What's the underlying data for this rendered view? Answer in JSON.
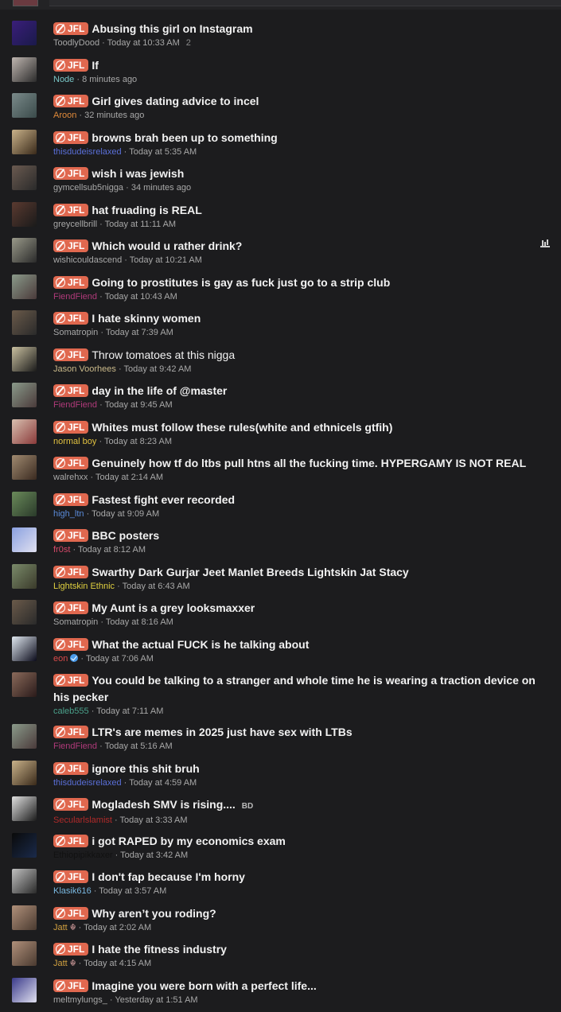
{
  "prefix_label": "JFL",
  "colors": {
    "prefix_bg": "#e0684f",
    "background": "#1c1c1e",
    "meta_gray": "#a8a8a8"
  },
  "threads": [
    {
      "title": "Abusing this girl on Instagram",
      "user": "ToodlyDood",
      "user_color": "#a8a8a8",
      "time": "Today at 10:33 AM",
      "replies": "2",
      "avatar": [
        "#3a1e7a",
        "#1a1a4a"
      ]
    },
    {
      "title": "If",
      "user": "Node",
      "user_color": "#79c7c7",
      "time": "8 minutes ago",
      "avatar": [
        "#bfb6b0",
        "#2b2b2b"
      ]
    },
    {
      "title": "Girl gives dating advice to incel",
      "user": "Aroon",
      "user_color": "#e08a3a",
      "time": "32 minutes ago",
      "avatar": [
        "#7a8a8a",
        "#3a4a4a"
      ]
    },
    {
      "title": "browns brah been up to something",
      "user": "thisdudeisrelaxed",
      "user_color": "#5a6fd8",
      "time": "Today at 5:35 AM",
      "avatar": [
        "#c9b28a",
        "#3a2a1a"
      ]
    },
    {
      "title": "wish i was jewish",
      "user": "gymcellsub5nigga",
      "user_color": "#a8a8a8",
      "time": "34 minutes ago",
      "avatar": [
        "#6a5a50",
        "#2a2a2a"
      ]
    },
    {
      "title": "hat fruading is REAL",
      "user": "greycellbrill",
      "user_color": "#a8a8a8",
      "time": "Today at 11:11 AM",
      "avatar": [
        "#5a3a30",
        "#1a1a1a"
      ]
    },
    {
      "title": "Which would u rather drink?",
      "user": "wishicouldascend",
      "user_color": "#a8a8a8",
      "time": "Today at 10:21 AM",
      "poll": true,
      "avatar": [
        "#9a9a8a",
        "#2a2a2a"
      ]
    },
    {
      "title": "Going to prostitutes is gay as fuck just go to a strip club",
      "user": "FiendFiend",
      "user_color": "#b03a7a",
      "time": "Today at 10:43 AM",
      "avatar": [
        "#8a9a8a",
        "#4a3a3a"
      ]
    },
    {
      "title": "I hate skinny women",
      "user": "Somatropin",
      "user_color": "#a8a8a8",
      "time": "Today at 7:39 AM",
      "avatar": [
        "#6a5a4a",
        "#2a2a2a"
      ]
    },
    {
      "title": "Throw tomatoes at this nigga",
      "user": "Jason Voorhees",
      "user_color": "#c9b98a",
      "time": "Today at 9:42 AM",
      "normal": true,
      "avatar": [
        "#c9c0a0",
        "#1a1a1a"
      ]
    },
    {
      "title": "day in the life of @master",
      "user": "FiendFiend",
      "user_color": "#b03a7a",
      "time": "Today at 9:45 AM",
      "avatar": [
        "#8a9a8a",
        "#4a3a3a"
      ]
    },
    {
      "title": "Whites must follow these rules(white and ethnicels gtfih)",
      "user": "normal boy",
      "user_color": "#e0c040",
      "time": "Today at 8:23 AM",
      "avatar": [
        "#d8c0b0",
        "#8a3a3a"
      ]
    },
    {
      "title": "Genuinely how tf do ltbs pull htns all the fucking time. HYPERGAMY IS NOT REAL",
      "user": "walrehxx",
      "user_color": "#a8a8a8",
      "time": "Today at 2:14 AM",
      "avatar": [
        "#a08a70",
        "#3a2a20"
      ]
    },
    {
      "title": "Fastest fight ever recorded",
      "user": "high_ltn",
      "user_color": "#5a8ad8",
      "time": "Today at 9:09 AM",
      "avatar": [
        "#6a8a5a",
        "#2a3a2a"
      ]
    },
    {
      "title": "BBC posters",
      "user": "fr0st",
      "user_color": "#d84a6a",
      "time": "Today at 8:12 AM",
      "avatar": [
        "#8aa0e0",
        "#e0e0f0"
      ]
    },
    {
      "title": "Swarthy Dark Gurjar Jeet Manlet Breeds Lightskin Jat Stacy",
      "user": "Lightskin Ethnic",
      "user_color": "#e0d040",
      "time": "Today at 6:43 AM",
      "avatar": [
        "#7a8a6a",
        "#3a3a2a"
      ]
    },
    {
      "title": "My Aunt is a grey looksmaxxer",
      "user": "Somatropin",
      "user_color": "#a8a8a8",
      "time": "Today at 8:16 AM",
      "avatar": [
        "#6a5a4a",
        "#2a2a2a"
      ]
    },
    {
      "title": "What the actual FUCK is he talking about",
      "user": "eon",
      "user_color": "#d84a4a",
      "time": "Today at 7:06 AM",
      "verified": true,
      "avatar": [
        "#e0e8f0",
        "#0a0a1a"
      ]
    },
    {
      "title": "You could be talking to a stranger and whole time he is wearing a traction device on his pecker",
      "user": "caleb555",
      "user_color": "#4aa08a",
      "time": "Today at 7:11 AM",
      "two_line": true,
      "avatar": [
        "#8a6a5a",
        "#2a1a1a"
      ]
    },
    {
      "title": "LTR's are memes in 2025 just have sex with LTBs",
      "user": "FiendFiend",
      "user_color": "#b03a7a",
      "time": "Today at 5:16 AM",
      "avatar": [
        "#8a9a8a",
        "#4a3a3a"
      ]
    },
    {
      "title": "ignore this shit bruh",
      "user": "thisdudeisrelaxed",
      "user_color": "#5a6fd8",
      "time": "Today at 4:59 AM",
      "avatar": [
        "#c9b28a",
        "#3a2a1a"
      ]
    },
    {
      "title": "Mogladesh SMV is rising.... ",
      "suffix": "BD",
      "user": "Secularlslamist",
      "user_color": "#b02a2a",
      "time": "Today at 3:33 AM",
      "avatar": [
        "#e0e0e0",
        "#1a1a1a"
      ]
    },
    {
      "title": "i got RAPED by my economics exam",
      "user": "Ethiopipikkaxer",
      "user_color": "#111111",
      "time": "Today at 3:42 AM",
      "avatar": [
        "#0a0a0a",
        "#1a2a4a"
      ]
    },
    {
      "title": "I don't fap because I'm horny",
      "user": "Klasik616",
      "user_color": "#7ab8e0",
      "time": "Today at 3:57 AM",
      "avatar": [
        "#c0c0c0",
        "#2a2a2a"
      ]
    },
    {
      "title": "Why aren’t you roding?",
      "user": "Jatt",
      "user_color": "#d0a040",
      "time": "Today at 2:02 AM",
      "glyph": "☬",
      "avatar": [
        "#b0907a",
        "#4a3a30"
      ]
    },
    {
      "title": "I hate the fitness industry",
      "user": "Jatt",
      "user_color": "#d0a040",
      "time": "Today at 4:15 AM",
      "glyph": "☬",
      "avatar": [
        "#b0907a",
        "#4a3a30"
      ]
    },
    {
      "title": "Imagine you were born with a perfect life...",
      "user": "meltmylungs_",
      "user_color": "#a8a8a8",
      "time": "Yesterday at 1:51 AM",
      "avatar": [
        "#3a3a8a",
        "#e0e0f0"
      ]
    }
  ]
}
